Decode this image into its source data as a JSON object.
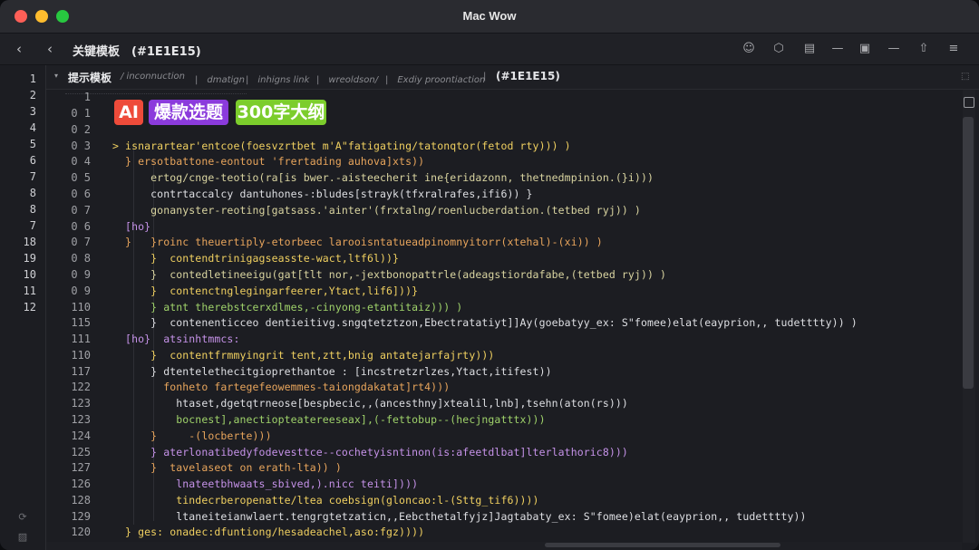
{
  "window": {
    "title": "Mac Wow"
  },
  "toolbar": {
    "title": "关键模板　(#1E1E15)",
    "back_icon": "chevron-left-icon",
    "forward_icon": "chevron-left-icon"
  },
  "tabs": {
    "main": "提示模板",
    "crumbs": [
      "/ inconnuction",
      "|　dmatign",
      "|　inhigns link",
      "|　wreoldson/",
      "|　Exdiy proontiaction",
      "|"
    ],
    "hex": "(#1E1E15)"
  },
  "gutter_numbers": [
    "1",
    "2",
    "3",
    "4",
    "5",
    "6",
    "7",
    "8",
    "8",
    "7",
    "18",
    "19",
    "10",
    "11",
    "12"
  ],
  "badges": {
    "ai": "AI",
    "hot": "爆款选题",
    "outline": "300字大纲"
  },
  "lines": [
    {
      "n": "1",
      "t": ""
    },
    {
      "n": "0 1",
      "t": ""
    },
    {
      "n": "0 2",
      "t": ""
    },
    {
      "n": "0 3",
      "t": "> isnarartear'entcoe(foesvzrtbet m'A\"fatigating/tatonqtor(fetod rty))) )"
    },
    {
      "n": "0 4",
      "t": "  } ersotbattone-eontout 'frertading auhova]xts))"
    },
    {
      "n": "0 5",
      "t": "      ertog/cnge-teotio(ra[is bwer.-aisteecherit ine{eridazonn, thetnedmpinion.(}i)))"
    },
    {
      "n": "0 6",
      "t": "      contrtaccalcy dantuhones-:bludes[strayk(tfxralrafes,ifi6)) }"
    },
    {
      "n": "0 7",
      "t": "      gonanyster-reoting[gatsass.'ainter'(frxtalng/roenlucberdation.(tetbed ryj)) )"
    },
    {
      "n": "0 6",
      "t": "  [ho}"
    },
    {
      "n": "0 7",
      "t": "  }   }roinc theuertiply-etorbeec larooisntatueadpinomnyitorr(xtehal)-(xi)) )"
    },
    {
      "n": "0 8",
      "t": "      }  contendtrinigagseasste-wact,ltf6l))}"
    },
    {
      "n": "0 9",
      "t": "      }  contedletineeigu(gat[tlt nor,-jextbonopattrle(adeagstiordafabe,(tetbed ryj)) )"
    },
    {
      "n": "0 9",
      "t": "      }  contenctnglegingarfeerer,Ytact,lif6]))}"
    },
    {
      "n": "110",
      "t": "      } atnt therebstcerxdlmes,-cinyong-etantitaiz))) )"
    },
    {
      "n": "115",
      "t": "      }  contenenticceo dentieitivg.sngqtetztzon,Ebectratatiyt]]Ay(goebatyy_ex: S\"fomee)elat(eayprion,, tudetttty)) )"
    },
    {
      "n": "111",
      "t": "  [ho}  atsinhtmmcs:"
    },
    {
      "n": "110",
      "t": "      }  contentfrmmyingrit tent,ztt,bnig antatejarfajrty)))"
    },
    {
      "n": "117",
      "t": "      } dtentelethecitgioprethantoe : [incstretzrlzes,Ytact,itifest))"
    },
    {
      "n": "122",
      "t": "        fonheto fartegefeowemmes-taiongdakatat]rt4)))"
    },
    {
      "n": "123",
      "t": "          htaset,dgetqtrneose[bespbecic,,(ancesthny]xtealil,lnb],tsehn(aton(rs)))"
    },
    {
      "n": "123",
      "t": "          bocnest],anectiopteatereeseax],(-fettobup--(hecjngatttx)))"
    },
    {
      "n": "124",
      "t": "      }     -(locberte)))"
    },
    {
      "n": "125",
      "t": "      } aterlonatibedyfodevesttce--cochetyisntinon(is:afeetdlbat]lterlathoric8)))"
    },
    {
      "n": "127",
      "t": "      }  tavelaseot on erath-lta)) )"
    },
    {
      "n": "126",
      "t": "          lnateetbhwaats_sbived,).nicc teiti])))"
    },
    {
      "n": "128",
      "t": "          tindecrberopenatte/ltea coebsign(gloncao:l-(Sttg_tif6))))"
    },
    {
      "n": "129",
      "t": "          ltaneiteianwlaert.tengrgtetzaticn,,Eebcthetalfyjz]Jagtabaty_ex: S\"fomee)elat(eayprion,, tudetttty))"
    },
    {
      "n": "120",
      "t": "  } ges: onadec:dfuntiong/hesadeachel,aso:fgz))))"
    }
  ]
}
